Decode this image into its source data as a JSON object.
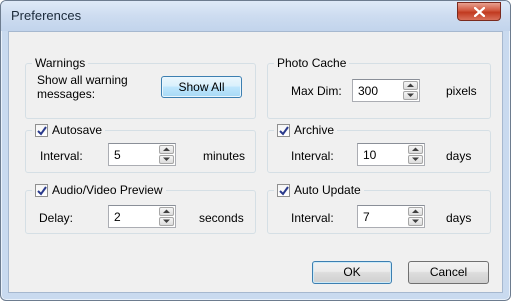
{
  "window": {
    "title": "Preferences"
  },
  "warnings": {
    "title": "Warnings",
    "text_line1": "Show all warning",
    "text_line2": "messages:",
    "button": "Show All"
  },
  "photo_cache": {
    "title": "Photo Cache",
    "label": "Max Dim:",
    "value": "300",
    "unit": "pixels"
  },
  "autosave": {
    "title": "Autosave",
    "checked": true,
    "label": "Interval:",
    "value": "5",
    "unit": "minutes"
  },
  "archive": {
    "title": "Archive",
    "checked": true,
    "label": "Interval:",
    "value": "10",
    "unit": "days"
  },
  "av_preview": {
    "title": "Audio/Video Preview",
    "checked": true,
    "label": "Delay:",
    "value": "2",
    "unit": "seconds"
  },
  "auto_update": {
    "title": "Auto Update",
    "checked": true,
    "label": "Interval:",
    "value": "7",
    "unit": "days"
  },
  "buttons": {
    "ok": "OK",
    "cancel": "Cancel"
  }
}
